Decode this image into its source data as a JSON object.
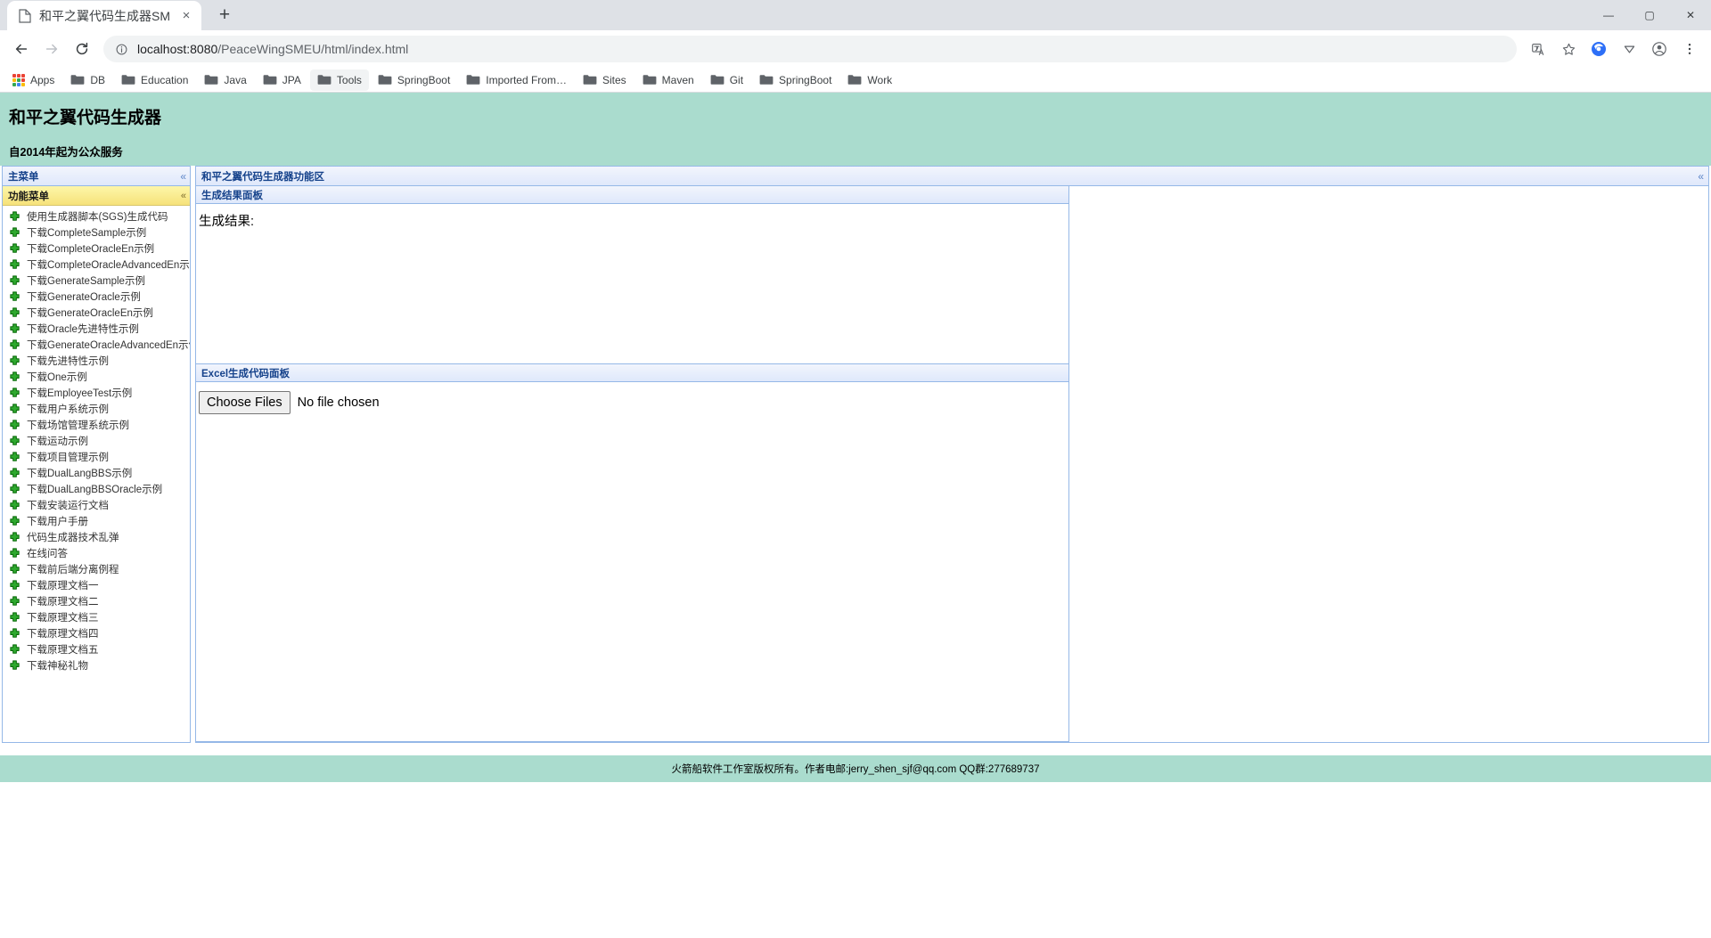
{
  "browser": {
    "tab": {
      "title": "和平之翼代码生成器SMEU",
      "favicon_icon": "page-icon",
      "close_icon": "×"
    },
    "new_tab_icon": "+",
    "window_controls": [
      {
        "name": "minimize-button",
        "glyph": "—"
      },
      {
        "name": "maximize-button",
        "glyph": "▢"
      },
      {
        "name": "close-window-button",
        "glyph": "✕"
      }
    ],
    "toolbar": {
      "back_icon": "←",
      "forward_icon": "→",
      "reload_icon": "⟳",
      "info_icon": "ⓘ",
      "url_host": "localhost:8080",
      "url_path": "/PeaceWingSMEU/html/index.html",
      "translate_icon": "翻",
      "bookmark_star_icon": "☆",
      "extension_icon": "ext",
      "downloads_icon": "▽",
      "profile_icon": "person-icon",
      "menu_icon": "⋮"
    },
    "bookmarks": {
      "apps_label": "Apps",
      "items": [
        {
          "label": "DB",
          "highlight": false
        },
        {
          "label": "Education",
          "highlight": false
        },
        {
          "label": "Java",
          "highlight": false
        },
        {
          "label": "JPA",
          "highlight": false
        },
        {
          "label": "Tools",
          "highlight": true
        },
        {
          "label": "SpringBoot",
          "highlight": false
        },
        {
          "label": "Imported From…",
          "highlight": false
        },
        {
          "label": "Sites",
          "highlight": false
        },
        {
          "label": "Maven",
          "highlight": false
        },
        {
          "label": "Git",
          "highlight": false
        },
        {
          "label": "SpringBoot",
          "highlight": false
        },
        {
          "label": "Work",
          "highlight": false
        }
      ]
    }
  },
  "page": {
    "header": {
      "title": "和平之翼代码生成器",
      "subtitle": "自2014年起为公众服务",
      "background": "#aadcce"
    },
    "sidebar": {
      "panel_title": "主菜单",
      "collapse_glyph": "«",
      "accordion_title": "功能菜单",
      "accordion_glyph": "«",
      "menu_items": [
        "使用生成器脚本(SGS)生成代码",
        "下载CompleteSample示例",
        "下载CompleteOracleEn示例",
        "下载CompleteOracleAdvancedEn示例",
        "下载GenerateSample示例",
        "下载GenerateOracle示例",
        "下载GenerateOracleEn示例",
        "下载Oracle先进特性示例",
        "下载GenerateOracleAdvancedEn示例",
        "下载先进特性示例",
        "下载One示例",
        "下载EmployeeTest示例",
        "下载用户系统示例",
        "下载场馆管理系统示例",
        "下载运动示例",
        "下载项目管理示例",
        "下载DualLangBBS示例",
        "下载DualLangBBSOracle示例",
        "下载安装运行文档",
        "下载用户手册",
        "代码生成器技术乱弹",
        "在线问答",
        "下载前后端分离例程",
        "下载原理文档一",
        "下载原理文档二",
        "下载原理文档三",
        "下载原理文档四",
        "下载原理文档五",
        "下载神秘礼物"
      ]
    },
    "main": {
      "panel_title": "和平之翼代码生成器功能区",
      "collapse_glyph": "«",
      "result_panel": {
        "title": "生成结果面板",
        "label": "生成结果:"
      },
      "excel_panel": {
        "title": "Excel生成代码面板",
        "file_button_label": "Choose Files",
        "file_status_text": "No file chosen"
      }
    },
    "footer": {
      "text": "火箭船软件工作室版权所有。作者电邮:jerry_shen_sjf@qq.com QQ群:277689737",
      "background": "#aadcce"
    }
  }
}
